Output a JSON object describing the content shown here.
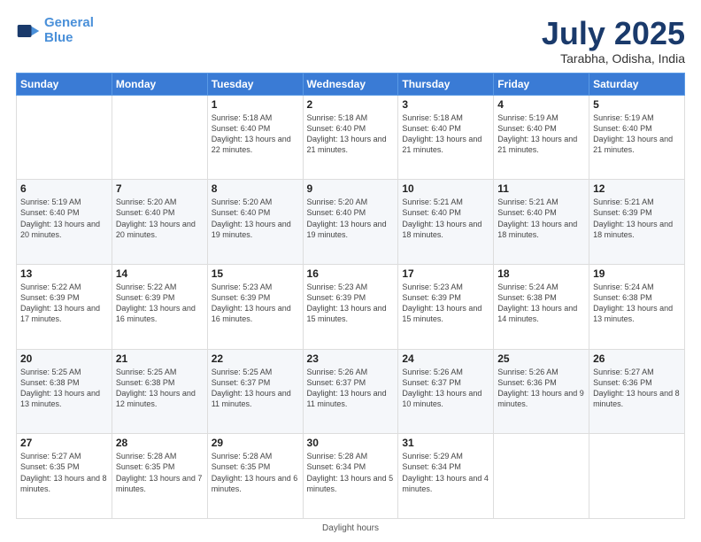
{
  "header": {
    "logo_line1": "General",
    "logo_line2": "Blue",
    "month": "July 2025",
    "location": "Tarabha, Odisha, India"
  },
  "weekdays": [
    "Sunday",
    "Monday",
    "Tuesday",
    "Wednesday",
    "Thursday",
    "Friday",
    "Saturday"
  ],
  "weeks": [
    [
      {
        "day": "",
        "info": ""
      },
      {
        "day": "",
        "info": ""
      },
      {
        "day": "1",
        "info": "Sunrise: 5:18 AM\nSunset: 6:40 PM\nDaylight: 13 hours and 22 minutes."
      },
      {
        "day": "2",
        "info": "Sunrise: 5:18 AM\nSunset: 6:40 PM\nDaylight: 13 hours and 21 minutes."
      },
      {
        "day": "3",
        "info": "Sunrise: 5:18 AM\nSunset: 6:40 PM\nDaylight: 13 hours and 21 minutes."
      },
      {
        "day": "4",
        "info": "Sunrise: 5:19 AM\nSunset: 6:40 PM\nDaylight: 13 hours and 21 minutes."
      },
      {
        "day": "5",
        "info": "Sunrise: 5:19 AM\nSunset: 6:40 PM\nDaylight: 13 hours and 21 minutes."
      }
    ],
    [
      {
        "day": "6",
        "info": "Sunrise: 5:19 AM\nSunset: 6:40 PM\nDaylight: 13 hours and 20 minutes."
      },
      {
        "day": "7",
        "info": "Sunrise: 5:20 AM\nSunset: 6:40 PM\nDaylight: 13 hours and 20 minutes."
      },
      {
        "day": "8",
        "info": "Sunrise: 5:20 AM\nSunset: 6:40 PM\nDaylight: 13 hours and 19 minutes."
      },
      {
        "day": "9",
        "info": "Sunrise: 5:20 AM\nSunset: 6:40 PM\nDaylight: 13 hours and 19 minutes."
      },
      {
        "day": "10",
        "info": "Sunrise: 5:21 AM\nSunset: 6:40 PM\nDaylight: 13 hours and 18 minutes."
      },
      {
        "day": "11",
        "info": "Sunrise: 5:21 AM\nSunset: 6:40 PM\nDaylight: 13 hours and 18 minutes."
      },
      {
        "day": "12",
        "info": "Sunrise: 5:21 AM\nSunset: 6:39 PM\nDaylight: 13 hours and 18 minutes."
      }
    ],
    [
      {
        "day": "13",
        "info": "Sunrise: 5:22 AM\nSunset: 6:39 PM\nDaylight: 13 hours and 17 minutes."
      },
      {
        "day": "14",
        "info": "Sunrise: 5:22 AM\nSunset: 6:39 PM\nDaylight: 13 hours and 16 minutes."
      },
      {
        "day": "15",
        "info": "Sunrise: 5:23 AM\nSunset: 6:39 PM\nDaylight: 13 hours and 16 minutes."
      },
      {
        "day": "16",
        "info": "Sunrise: 5:23 AM\nSunset: 6:39 PM\nDaylight: 13 hours and 15 minutes."
      },
      {
        "day": "17",
        "info": "Sunrise: 5:23 AM\nSunset: 6:39 PM\nDaylight: 13 hours and 15 minutes."
      },
      {
        "day": "18",
        "info": "Sunrise: 5:24 AM\nSunset: 6:38 PM\nDaylight: 13 hours and 14 minutes."
      },
      {
        "day": "19",
        "info": "Sunrise: 5:24 AM\nSunset: 6:38 PM\nDaylight: 13 hours and 13 minutes."
      }
    ],
    [
      {
        "day": "20",
        "info": "Sunrise: 5:25 AM\nSunset: 6:38 PM\nDaylight: 13 hours and 13 minutes."
      },
      {
        "day": "21",
        "info": "Sunrise: 5:25 AM\nSunset: 6:38 PM\nDaylight: 13 hours and 12 minutes."
      },
      {
        "day": "22",
        "info": "Sunrise: 5:25 AM\nSunset: 6:37 PM\nDaylight: 13 hours and 11 minutes."
      },
      {
        "day": "23",
        "info": "Sunrise: 5:26 AM\nSunset: 6:37 PM\nDaylight: 13 hours and 11 minutes."
      },
      {
        "day": "24",
        "info": "Sunrise: 5:26 AM\nSunset: 6:37 PM\nDaylight: 13 hours and 10 minutes."
      },
      {
        "day": "25",
        "info": "Sunrise: 5:26 AM\nSunset: 6:36 PM\nDaylight: 13 hours and 9 minutes."
      },
      {
        "day": "26",
        "info": "Sunrise: 5:27 AM\nSunset: 6:36 PM\nDaylight: 13 hours and 8 minutes."
      }
    ],
    [
      {
        "day": "27",
        "info": "Sunrise: 5:27 AM\nSunset: 6:35 PM\nDaylight: 13 hours and 8 minutes."
      },
      {
        "day": "28",
        "info": "Sunrise: 5:28 AM\nSunset: 6:35 PM\nDaylight: 13 hours and 7 minutes."
      },
      {
        "day": "29",
        "info": "Sunrise: 5:28 AM\nSunset: 6:35 PM\nDaylight: 13 hours and 6 minutes."
      },
      {
        "day": "30",
        "info": "Sunrise: 5:28 AM\nSunset: 6:34 PM\nDaylight: 13 hours and 5 minutes."
      },
      {
        "day": "31",
        "info": "Sunrise: 5:29 AM\nSunset: 6:34 PM\nDaylight: 13 hours and 4 minutes."
      },
      {
        "day": "",
        "info": ""
      },
      {
        "day": "",
        "info": ""
      }
    ]
  ],
  "footer": {
    "daylight_label": "Daylight hours"
  }
}
